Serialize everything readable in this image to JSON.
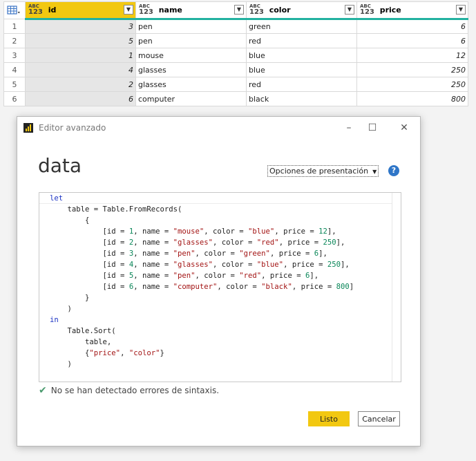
{
  "table": {
    "columns": [
      {
        "type_top": "ABC",
        "type_bottom": "123",
        "name": "id"
      },
      {
        "type_top": "ABC",
        "type_bottom": "123",
        "name": "name"
      },
      {
        "type_top": "ABC",
        "type_bottom": "123",
        "name": "color"
      },
      {
        "type_top": "ABC",
        "type_bottom": "123",
        "name": "price"
      }
    ],
    "rows": [
      {
        "n": "1",
        "id": "3",
        "name": "pen",
        "color": "green",
        "price": "6"
      },
      {
        "n": "2",
        "id": "5",
        "name": "pen",
        "color": "red",
        "price": "6"
      },
      {
        "n": "3",
        "id": "1",
        "name": "mouse",
        "color": "blue",
        "price": "12"
      },
      {
        "n": "4",
        "id": "4",
        "name": "glasses",
        "color": "blue",
        "price": "250"
      },
      {
        "n": "5",
        "id": "2",
        "name": "glasses",
        "color": "red",
        "price": "250"
      },
      {
        "n": "6",
        "id": "6",
        "name": "computer",
        "color": "black",
        "price": "800"
      }
    ]
  },
  "dialog": {
    "title": "Editor avanzado",
    "query_name": "data",
    "options_label": "Opciones de presentación",
    "help_label": "?",
    "status_text": "No se han detectado errores de sintaxis.",
    "ok_label": "Listo",
    "cancel_label": "Cancelar"
  },
  "code": {
    "l1": "let",
    "l2a": "    table = Table.FromRecords(",
    "l3": "        {",
    "records": [
      {
        "id": "1",
        "name": "\"mouse\"",
        "color": "\"blue\"",
        "price": "12",
        "end": "],"
      },
      {
        "id": "2",
        "name": "\"glasses\"",
        "color": "\"red\"",
        "price": "250",
        "end": "],"
      },
      {
        "id": "3",
        "name": "\"pen\"",
        "color": "\"green\"",
        "price": "6",
        "end": "],"
      },
      {
        "id": "4",
        "name": "\"glasses\"",
        "color": "\"blue\"",
        "price": "250",
        "end": "],"
      },
      {
        "id": "5",
        "name": "\"pen\"",
        "color": "\"red\"",
        "price": "6",
        "end": "],"
      },
      {
        "id": "6",
        "name": "\"computer\"",
        "color": "\"black\"",
        "price": "800",
        "end": "]"
      }
    ],
    "l10": "        }",
    "l11": "    )",
    "l12": "in",
    "l13": "    Table.Sort(",
    "l14": "        table,",
    "l15a": "        {",
    "l15s1": "\"price\"",
    "l15m": ", ",
    "l15s2": "\"color\"",
    "l15b": "}",
    "l16": "    )"
  }
}
